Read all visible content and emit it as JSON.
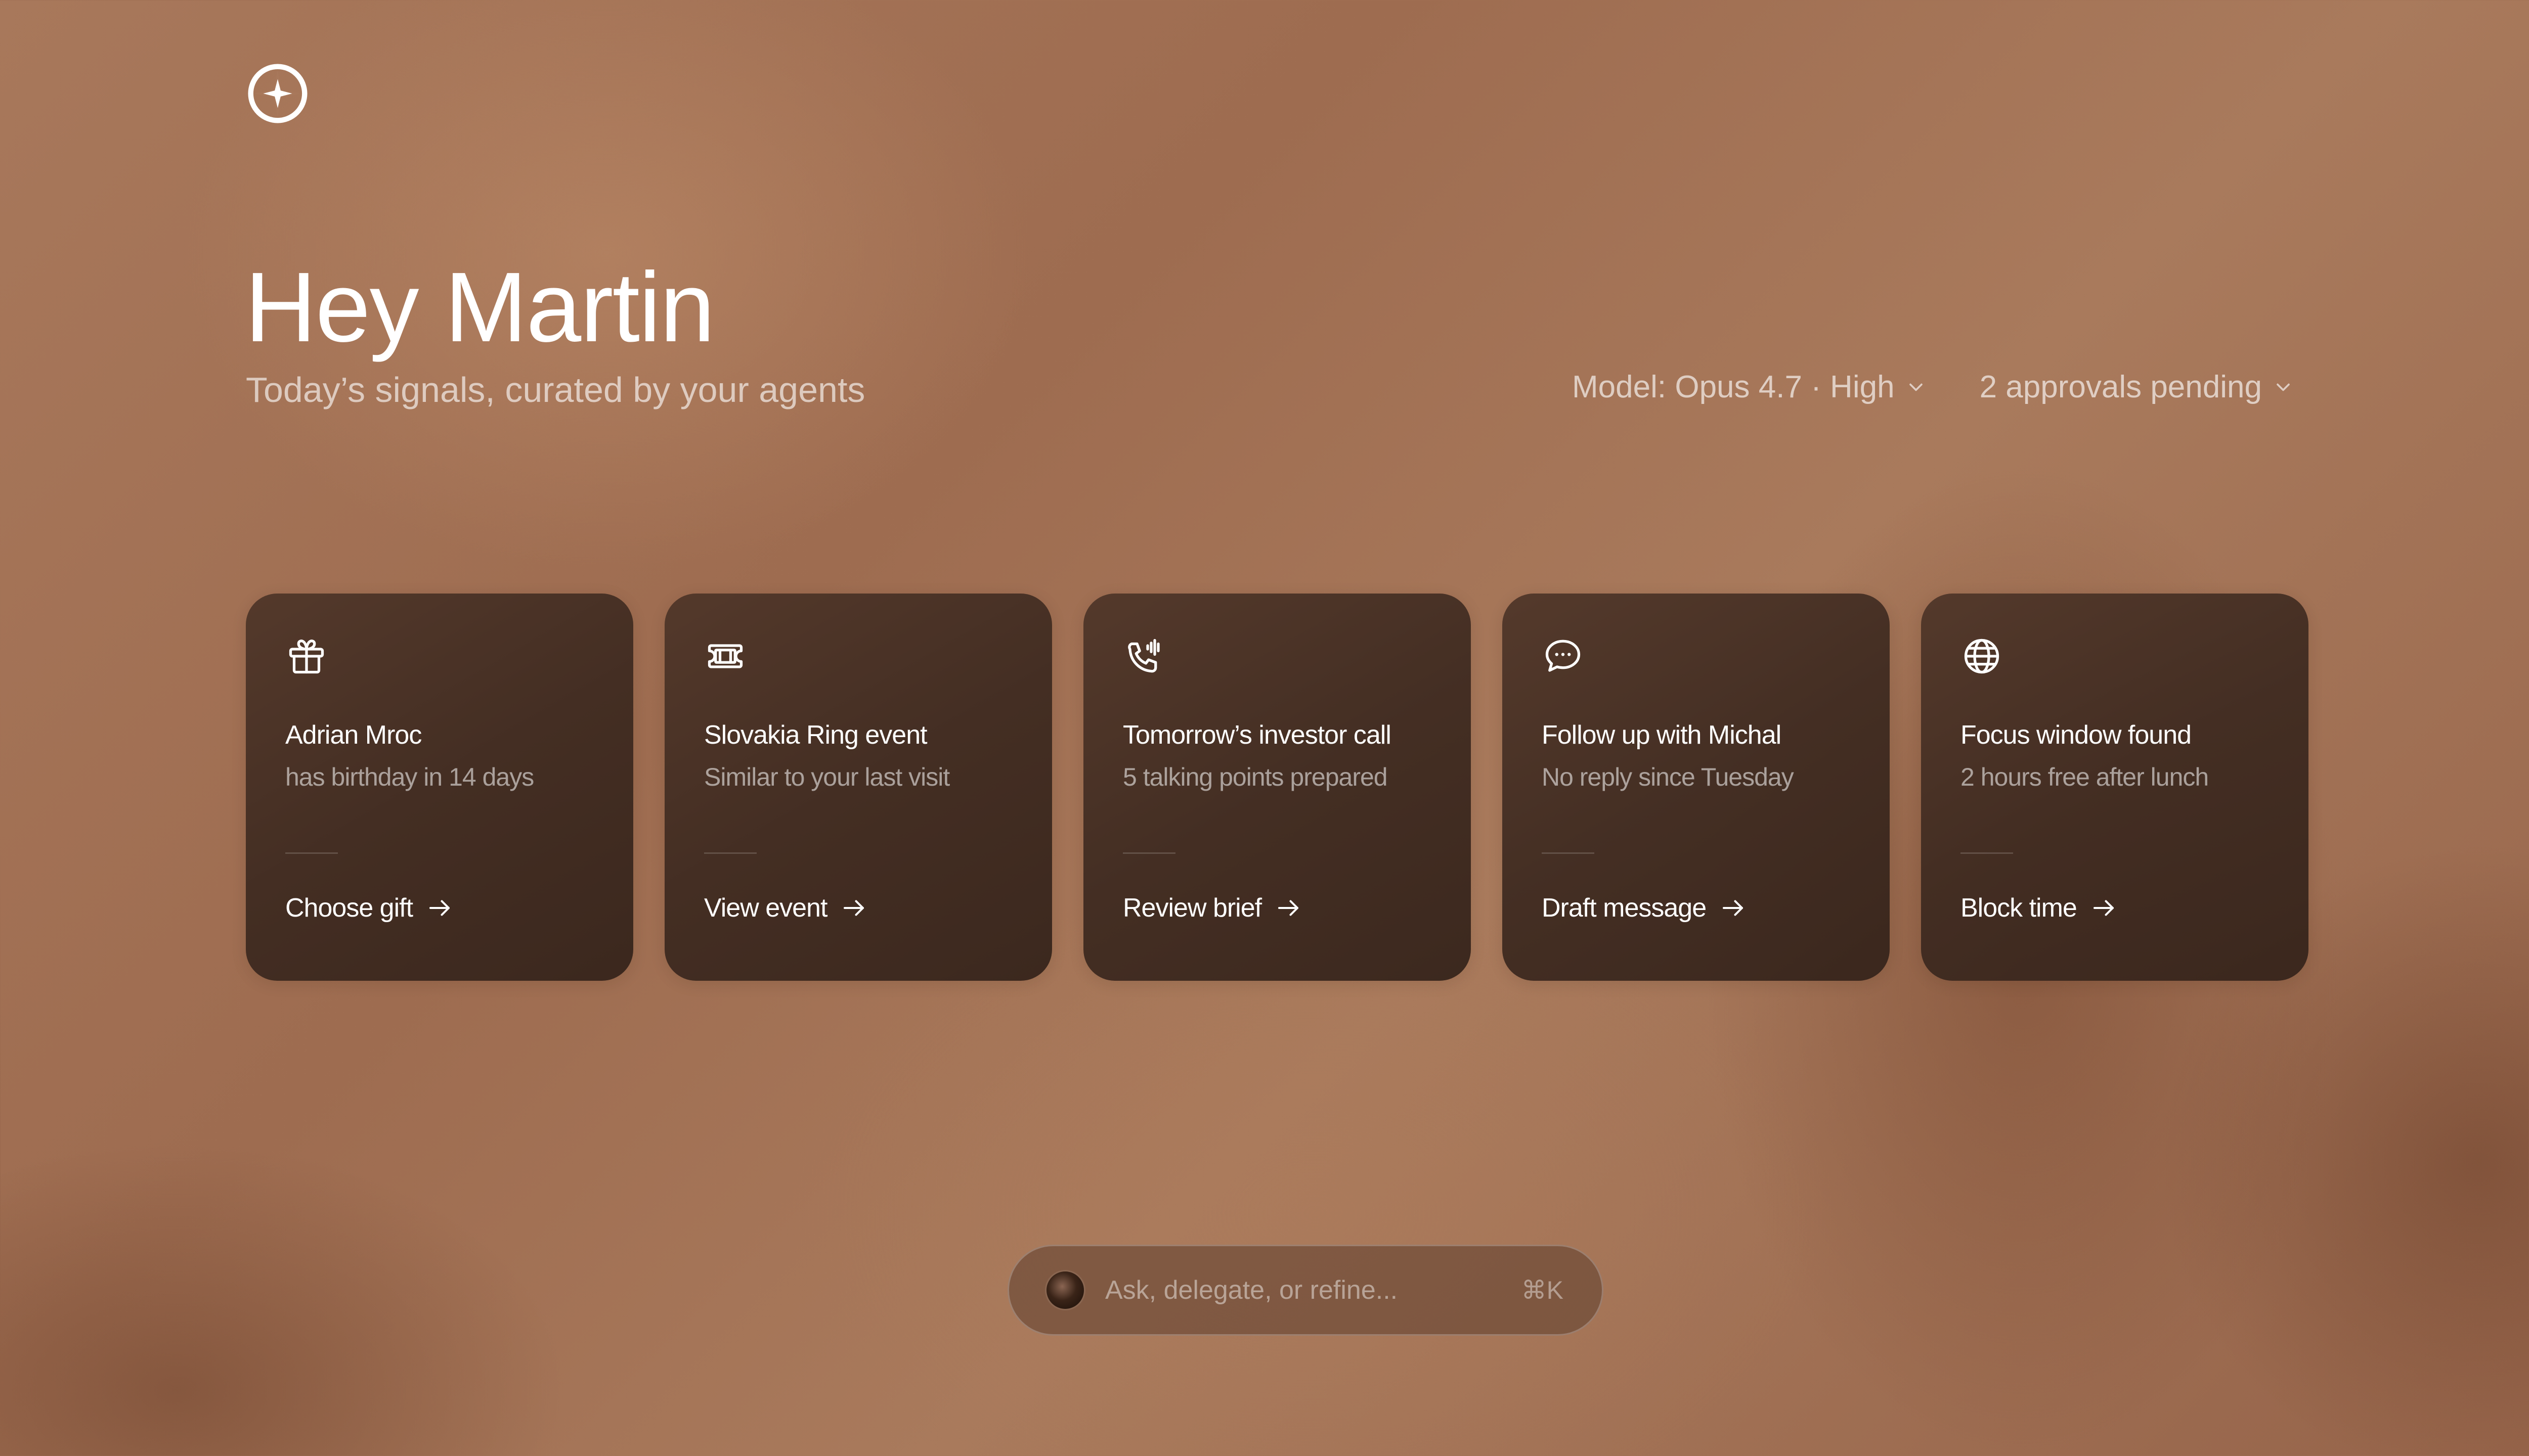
{
  "app": {
    "logo_icon": "compass-star-icon"
  },
  "header": {
    "greeting": "Hey Martin",
    "subtitle": "Today’s signals, curated by your agents"
  },
  "controls": {
    "model_label": "Model: Opus 4.7 · High",
    "approvals_label": "2 approvals pending"
  },
  "cards": [
    {
      "icon": "gift-icon",
      "title": "Adrian Mroc",
      "subtitle": "has birthday in 14 days",
      "action": "Choose gift"
    },
    {
      "icon": "ticket-icon",
      "title": "Slovakia Ring event",
      "subtitle": "Similar to your last visit",
      "action": "View event"
    },
    {
      "icon": "phone-call-icon",
      "title": "Tomorrow’s investor call",
      "subtitle": "5 talking points prepared",
      "action": "Review brief"
    },
    {
      "icon": "chat-bubble-icon",
      "title": "Follow up with Michal",
      "subtitle": "No reply since Tuesday",
      "action": "Draft message"
    },
    {
      "icon": "globe-icon",
      "title": "Focus window found",
      "subtitle": "2 hours free after lunch",
      "action": "Block time"
    }
  ],
  "prompt": {
    "placeholder": "Ask, delegate, or refine...",
    "shortcut": "⌘K"
  },
  "colors": {
    "background": "#a8785b",
    "card": "#4a3226",
    "text": "#ffffff"
  }
}
